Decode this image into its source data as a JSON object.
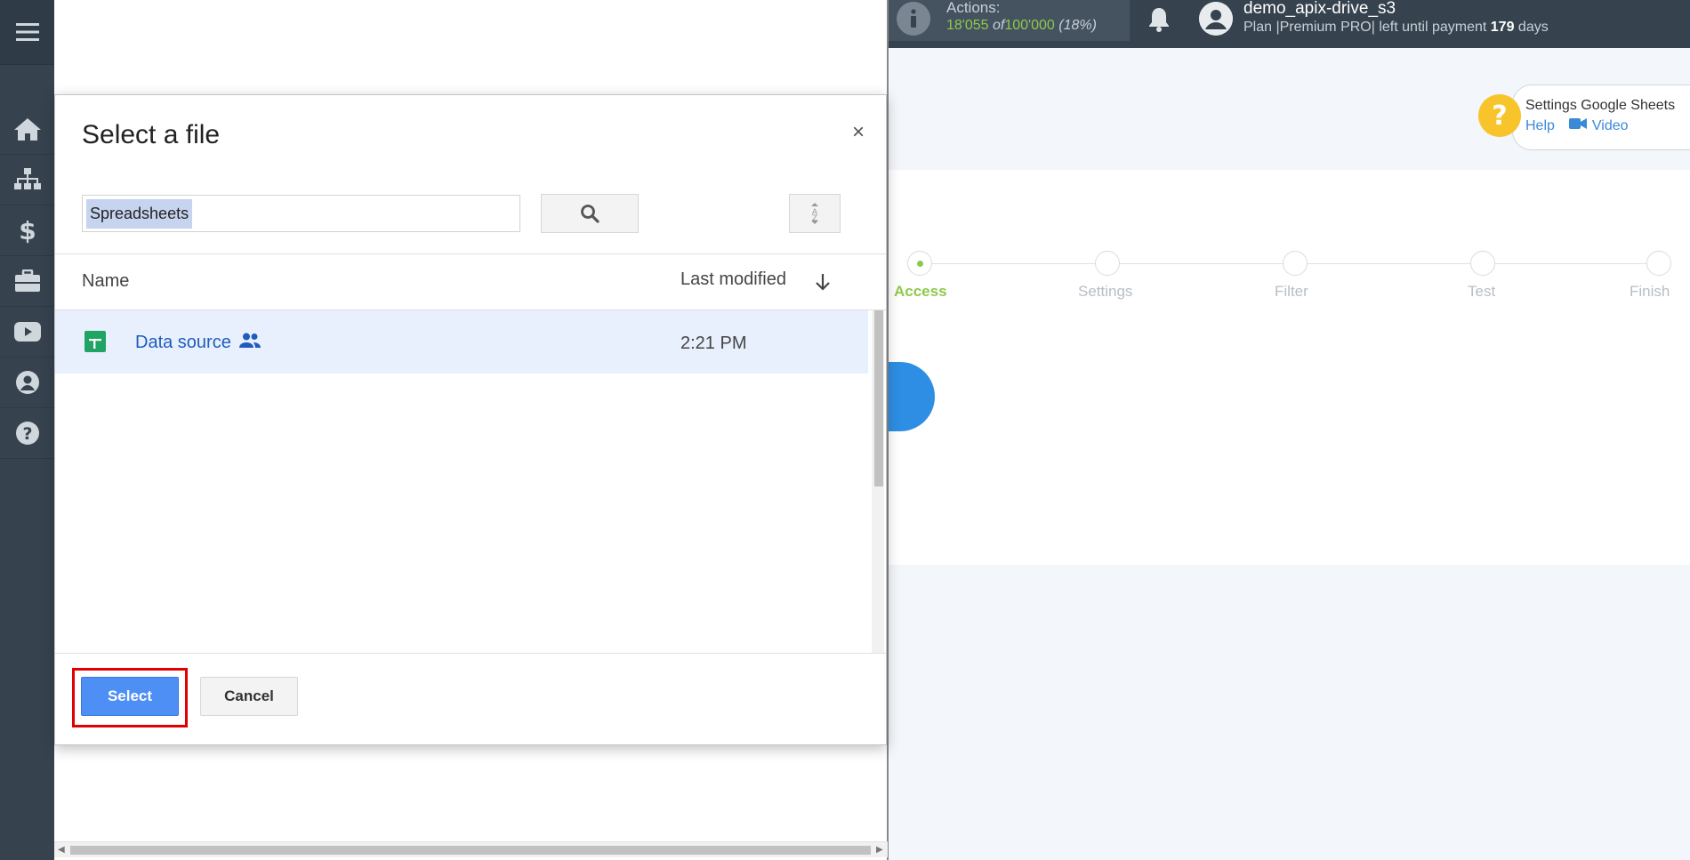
{
  "sidebar": {
    "items": [
      {
        "icon": "home-icon"
      },
      {
        "icon": "sitemap-icon"
      },
      {
        "icon": "dollar-icon"
      },
      {
        "icon": "briefcase-icon"
      },
      {
        "icon": "youtube-icon"
      },
      {
        "icon": "user-icon"
      },
      {
        "icon": "help-icon"
      }
    ]
  },
  "topbar": {
    "actions_label": "Actions:",
    "actions_used": "18'055",
    "actions_of": "of",
    "actions_total": "100'000",
    "actions_percent": "(18%)",
    "username": "demo_apix-drive_s3",
    "plan_prefix": "Plan |Premium PRO| left until payment",
    "plan_days": "179",
    "plan_suffix": "days"
  },
  "help": {
    "title": "Settings Google Sheets",
    "help_link": "Help",
    "video_link": "Video"
  },
  "steps": [
    {
      "label": "Access",
      "active": true
    },
    {
      "label": "Settings",
      "active": false
    },
    {
      "label": "Filter",
      "active": false
    },
    {
      "label": "Test",
      "active": false
    },
    {
      "label": "Finish",
      "active": false
    }
  ],
  "picker": {
    "title": "Select a file",
    "close": "×",
    "search_value": "Spreadsheets",
    "columns": {
      "name": "Name",
      "modified": "Last modified"
    },
    "files": [
      {
        "name": "Data source",
        "modified": "2:21 PM"
      }
    ],
    "select_label": "Select",
    "cancel_label": "Cancel"
  },
  "colors": {
    "sidebar": "#36434f",
    "accent_green": "#8fc94b",
    "select_blue": "#4d8ff5",
    "highlight_red": "#e00000"
  }
}
